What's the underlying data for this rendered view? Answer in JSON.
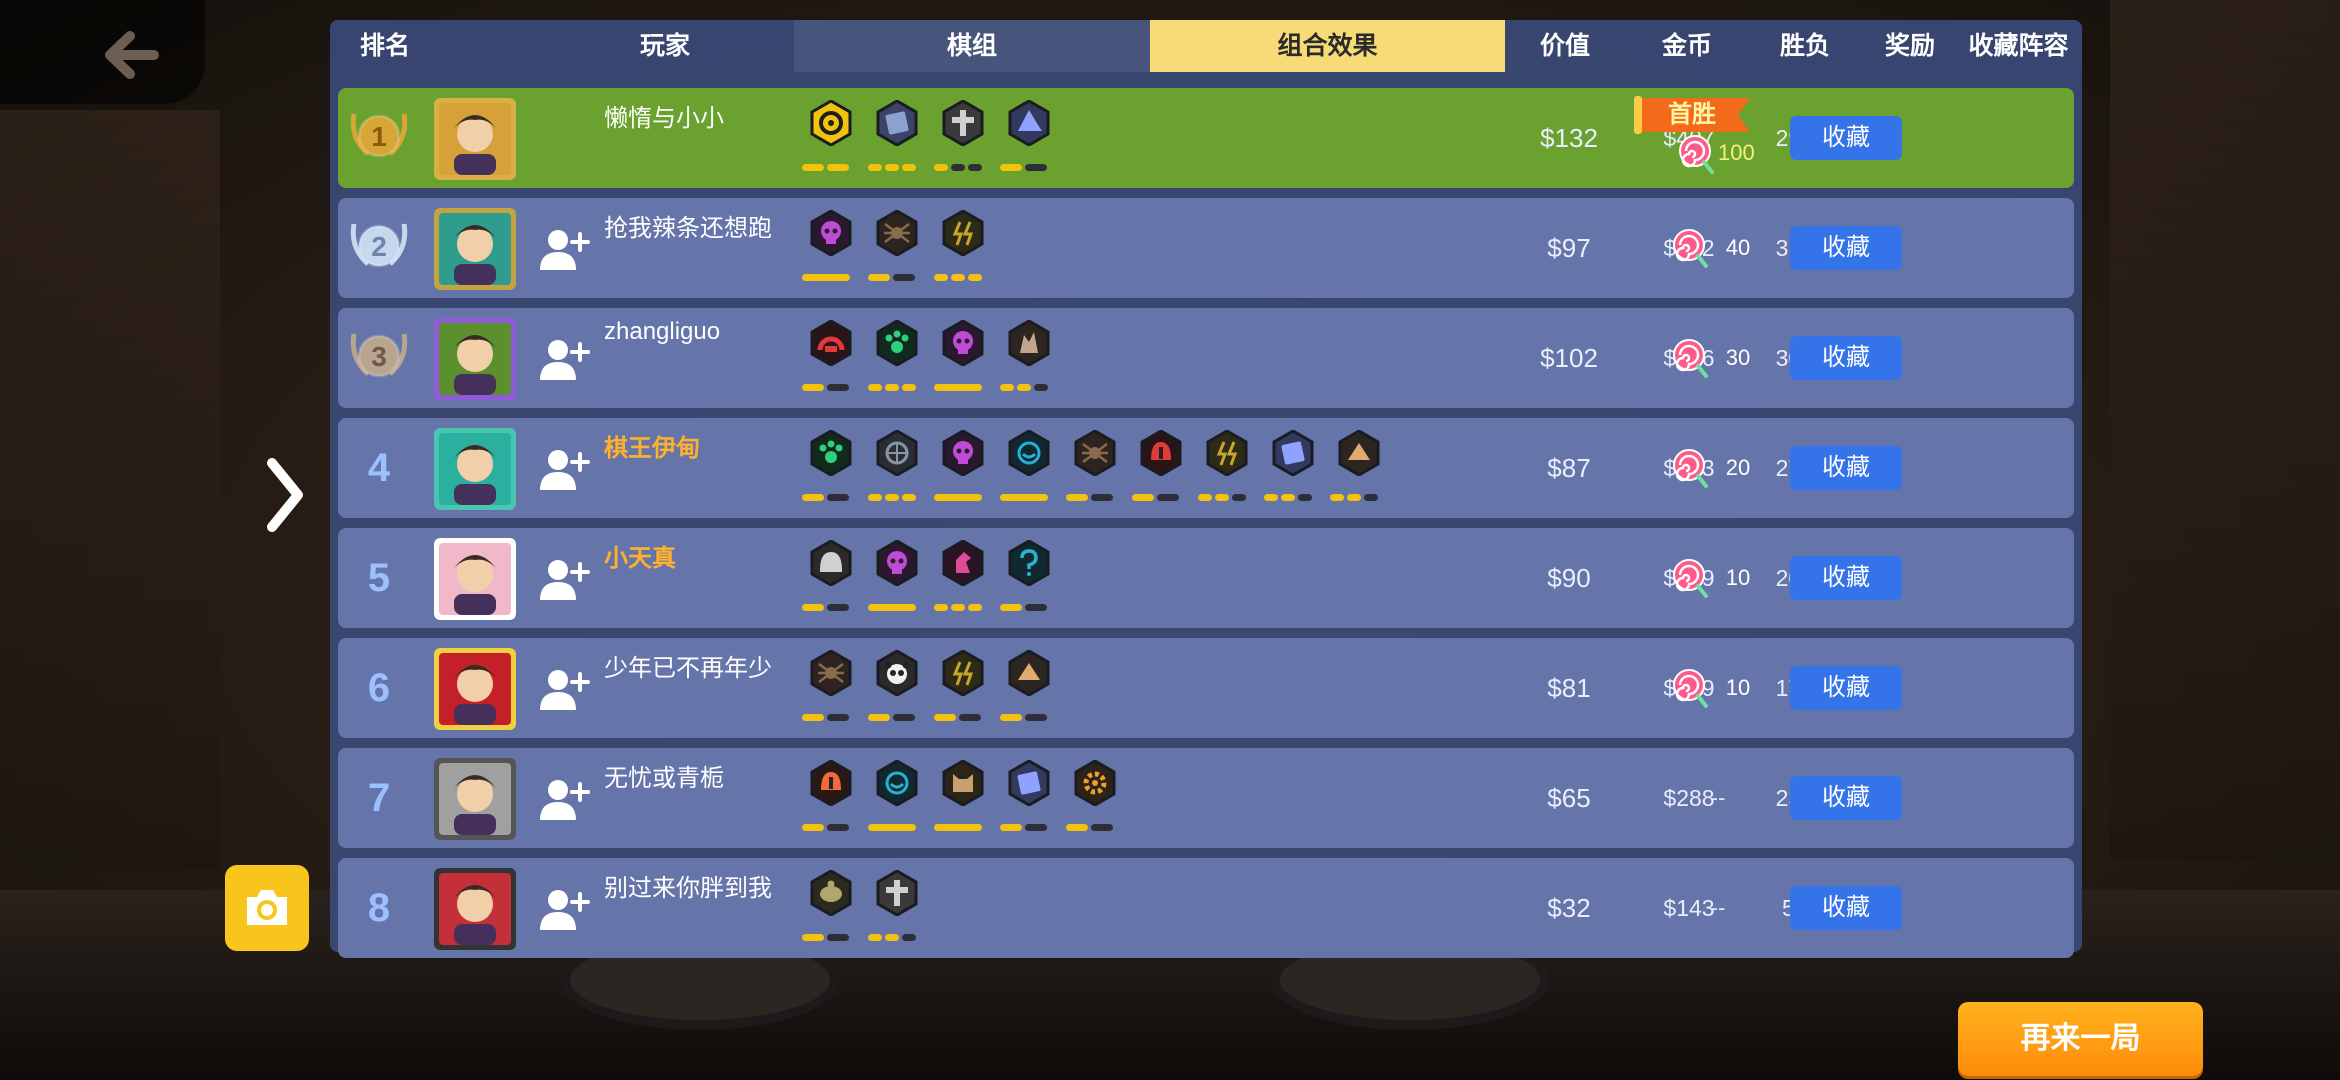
{
  "header": {
    "rank": "排名",
    "player": "玩家",
    "deck": "棋组",
    "combo": "组合效果",
    "value": "价值",
    "coins": "金币",
    "win_loss": "胜负",
    "reward": "奖励",
    "collection": "收藏阵容"
  },
  "first_win_label": "首胜",
  "collect_label": "收藏",
  "play_again_label": "再来一局",
  "colors": {
    "panel": "#3b4a78",
    "row": "#6575aa",
    "first_row": "#6ba22f",
    "active_tab": "#f6db76",
    "collect_button": "#3474e8",
    "bar_on": "#f2c20c"
  },
  "rows": [
    {
      "rank": "1",
      "name": "懒惰与小小",
      "gold_name": false,
      "value": "$132",
      "coins": "$407",
      "wl": "29-16",
      "reward": "100",
      "first": true,
      "traits": [
        [
          "#f2c20c",
          "#1f1f1f",
          "ring"
        ],
        [
          "#3a4466",
          "#8ea0d0",
          "book"
        ],
        [
          "#3a3a3a",
          "#d0d0d0",
          "cross"
        ],
        [
          "#323a5e",
          "#8fa2ff",
          "hat"
        ]
      ],
      "bars": [
        [
          2,
          2
        ],
        [
          0,
          3
        ],
        [
          1,
          3
        ],
        [
          1,
          2
        ]
      ]
    },
    {
      "rank": "2",
      "name": "抢我辣条还想跑",
      "gold_name": false,
      "value": "$97",
      "coins": "$412",
      "wl": "31-16",
      "reward": "40",
      "first": false,
      "traits": [
        [
          "#2a1830",
          "#c14ad8",
          "skull"
        ],
        [
          "#2d2420",
          "#8a6a4c",
          "spider"
        ],
        [
          "#2d2a18",
          "#c9a52a",
          "bolt"
        ]
      ],
      "bars": [
        [
          1,
          1
        ],
        [
          1,
          2
        ],
        [
          0,
          3
        ]
      ]
    },
    {
      "rank": "3",
      "name": "zhangliguo",
      "gold_name": false,
      "value": "$102",
      "coins": "$366",
      "wl": "30-14",
      "reward": "30",
      "first": false,
      "traits": [
        [
          "#2a1418",
          "#e03a3a",
          "arch"
        ],
        [
          "#102a1e",
          "#2ed07a",
          "paw"
        ],
        [
          "#2a1830",
          "#c14ad8",
          "skull"
        ],
        [
          "#2d2620",
          "#c0a690",
          "flame"
        ]
      ],
      "bars": [
        [
          1,
          2
        ],
        [
          0,
          3
        ],
        [
          1,
          1
        ],
        [
          2,
          3
        ]
      ]
    },
    {
      "rank": "4",
      "name": "棋王伊甸",
      "gold_name": true,
      "value": "$87",
      "coins": "$363",
      "wl": "27-14",
      "reward": "20",
      "first": false,
      "traits": [
        [
          "#102a1e",
          "#2ed07a",
          "paw"
        ],
        [
          "#2a2e34",
          "#8a96a8",
          "globe"
        ],
        [
          "#2a1830",
          "#c14ad8",
          "skull"
        ],
        [
          "#102830",
          "#2ab0d0",
          "mask"
        ],
        [
          "#2d2420",
          "#8a6a4c",
          "spider"
        ],
        [
          "#2a1418",
          "#e03a3a",
          "helm"
        ],
        [
          "#2d2a18",
          "#c9a52a",
          "bolt"
        ],
        [
          "#323a5e",
          "#8fa2ff",
          "book"
        ],
        [
          "#2d2620",
          "#e0aa70",
          "drop"
        ]
      ],
      "bars": [
        [
          1,
          2
        ],
        [
          0,
          3
        ],
        [
          1,
          1
        ],
        [
          1,
          1
        ],
        [
          1,
          2
        ],
        [
          1,
          2
        ],
        [
          2,
          3
        ],
        [
          2,
          3
        ],
        [
          2,
          3
        ]
      ]
    },
    {
      "rank": "5",
      "name": "小天真",
      "gold_name": true,
      "value": "$90",
      "coins": "$289",
      "wl": "20-14",
      "reward": "10",
      "first": false,
      "traits": [
        [
          "#2a2a2a",
          "#d0d0d0",
          "dome"
        ],
        [
          "#2a1830",
          "#c14ad8",
          "skull"
        ],
        [
          "#2a1424",
          "#e04a9a",
          "horse"
        ],
        [
          "#102830",
          "#2ab0d0",
          "q"
        ]
      ],
      "bars": [
        [
          1,
          2
        ],
        [
          1,
          1
        ],
        [
          0,
          3
        ],
        [
          1,
          2
        ]
      ]
    },
    {
      "rank": "6",
      "name": "少年已不再年少",
      "gold_name": false,
      "value": "$81",
      "coins": "$259",
      "wl": "17-16",
      "reward": "10",
      "first": false,
      "traits": [
        [
          "#2d2420",
          "#8a6a4c",
          "spider"
        ],
        [
          "#2a2a2a",
          "#f0f0f0",
          "panda"
        ],
        [
          "#2d2a18",
          "#c9a52a",
          "bolt"
        ],
        [
          "#2d2620",
          "#e0aa70",
          "drop"
        ]
      ],
      "bars": [
        [
          1,
          2
        ],
        [
          1,
          2
        ],
        [
          1,
          2
        ],
        [
          1,
          2
        ]
      ]
    },
    {
      "rank": "7",
      "name": "无忧或青栀",
      "gold_name": false,
      "value": "$65",
      "coins": "$288",
      "wl": "23-10",
      "reward": "--",
      "first": false,
      "traits": [
        [
          "#2a1814",
          "#f06a3a",
          "helm"
        ],
        [
          "#102830",
          "#2ab0d0",
          "mask"
        ],
        [
          "#2d2418",
          "#c9a070",
          "cat"
        ],
        [
          "#323a5e",
          "#8fa2ff",
          "book"
        ],
        [
          "#2d2418",
          "#f0a030",
          "gear"
        ]
      ],
      "bars": [
        [
          1,
          2
        ],
        [
          1,
          1
        ],
        [
          1,
          1
        ],
        [
          1,
          2
        ],
        [
          1,
          2
        ]
      ]
    },
    {
      "rank": "8",
      "name": "别过来你胖到我",
      "gold_name": false,
      "value": "$32",
      "coins": "$143",
      "wl": "5-13",
      "reward": "--",
      "first": false,
      "traits": [
        [
          "#2a2a1e",
          "#b0a86a",
          "turtle"
        ],
        [
          "#3a3a3a",
          "#d0d0d0",
          "cross"
        ]
      ],
      "bars": [
        [
          1,
          2
        ],
        [
          2,
          3
        ]
      ]
    }
  ]
}
